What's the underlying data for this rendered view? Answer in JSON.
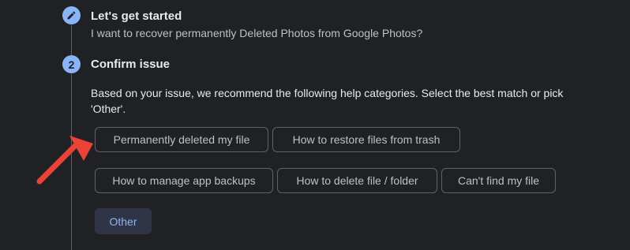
{
  "steps": [
    {
      "number": "",
      "icon": "pencil-icon",
      "title": "Let's get started",
      "subtitle": "I want to recover permanently Deleted Photos from Google Photos?"
    },
    {
      "number": "2",
      "title": "Confirm issue",
      "description": "Based on your issue, we recommend the following help categories. Select the best match or pick 'Other'."
    }
  ],
  "categories": [
    "Permanently deleted my file",
    "How to restore files from trash",
    "How to manage app backups",
    "How to delete file / folder",
    "Can't find my file"
  ],
  "other_label": "Other",
  "colors": {
    "background": "#202124",
    "accent": "#8ab4f8",
    "chip_border": "#5f6368",
    "annotation_arrow": "#ea4335"
  }
}
